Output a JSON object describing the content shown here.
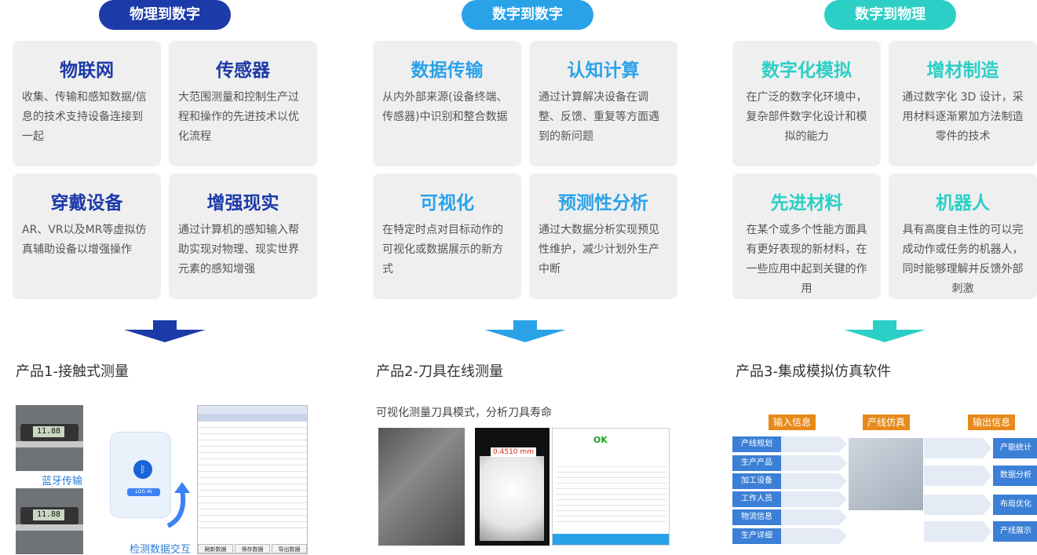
{
  "columns": [
    {
      "pill": "物理到数字",
      "color": "#1c3aa8",
      "cards": [
        {
          "title": "物联网",
          "desc": "收集、传输和感知数据/信息的技术支持设备连接到一起"
        },
        {
          "title": "传感器",
          "desc": "大范围测量和控制生产过程和操作的先进技术以优化流程"
        },
        {
          "title": "穿戴设备",
          "desc": "AR、VR以及MR等虚拟仿真辅助设备以增强操作"
        },
        {
          "title": "增强现实",
          "desc": "通过计算机的感知输入帮助实现对物理、现实世界元素的感知增强"
        }
      ],
      "product": "产品1-接触式测量",
      "labels": {
        "bluetooth": "蓝牙传输",
        "interaction": "检测数据交互",
        "login": "LOG IN",
        "reading1": "11.88",
        "reading2": "11.88"
      },
      "table_buttons": [
        "刷新数据",
        "保存数据",
        "导出数据"
      ]
    },
    {
      "pill": "数字到数字",
      "color": "#2aa2e8",
      "cards": [
        {
          "title": "数据传输",
          "desc": "从内外部来源(设备终端、传感器)中识别和整合数据"
        },
        {
          "title": "认知计算",
          "desc": "通过计算解决设备在调整、反馈、重复等方面遇到的新问题"
        },
        {
          "title": "可视化",
          "desc": "在特定时点对目标动作的可视化或数据展示的新方式"
        },
        {
          "title": "预测性分析",
          "desc": "通过大数据分析实现预见性维护，减少计划外生产中断"
        }
      ],
      "product": "产品2-刀具在线测量",
      "subtitle": "可视化测量刀具模式，分析刀具寿命",
      "measure": "0.4510 mm",
      "ok": "OK"
    },
    {
      "pill": "数字到物理",
      "color": "#2bcfc6",
      "cards": [
        {
          "title": "数字化模拟",
          "desc": "在广泛的数字化环境中，复杂部件数字化设计和模拟的能力"
        },
        {
          "title": "增材制造",
          "desc": "通过数字化 3D 设计，采用材料逐渐累加方法制造零件的技术"
        },
        {
          "title": "先进材料",
          "desc": "在某个或多个性能方面具有更好表现的新材料，在一些应用中起到关键的作用"
        },
        {
          "title": "机器人",
          "desc": "具有高度自主性的可以完成动作或任务的机器人，同时能够理解并反馈外部刺激"
        }
      ],
      "product": "产品3-集成模拟仿真软件",
      "flow": {
        "headers": [
          "输入信息",
          "产线仿真",
          "输出信息"
        ],
        "inputs": [
          "产线规划",
          "生产产品",
          "加工设备",
          "工作人员",
          "物流信息",
          "生产详细"
        ],
        "outputs": [
          "产能统计",
          "数据分析",
          "布局优化",
          "产线展示"
        ]
      }
    }
  ]
}
